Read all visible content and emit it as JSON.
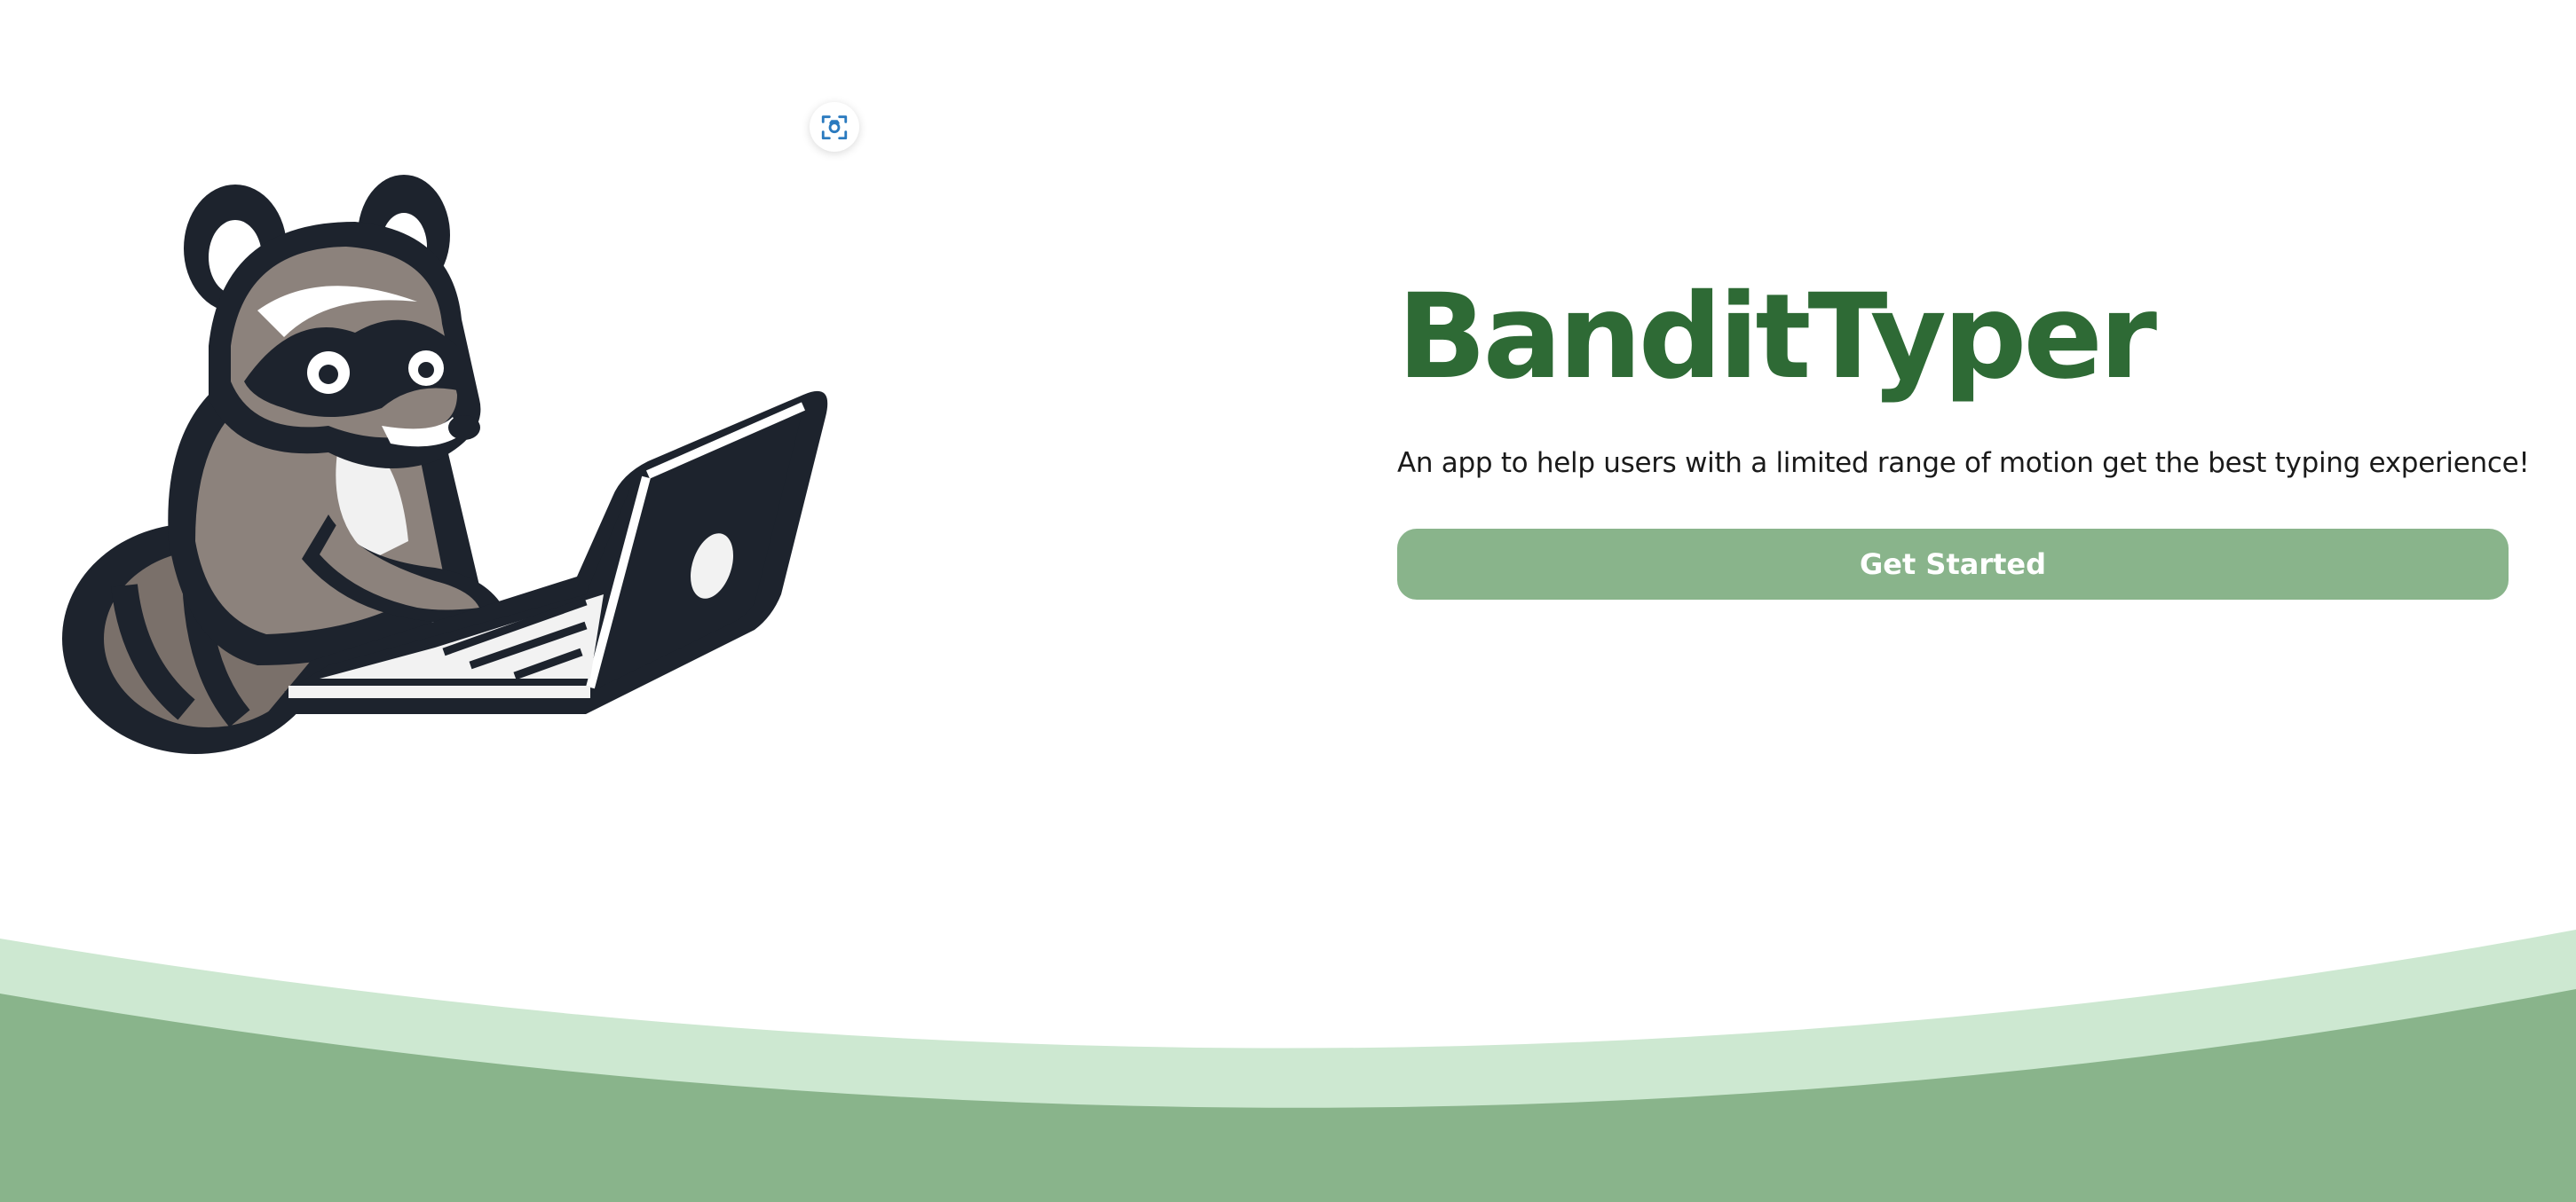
{
  "hero": {
    "title": "BanditTyper",
    "subtitle": "An app to help users with a limited range of motion get the best typing experience!",
    "cta_label": "Get Started"
  },
  "icons": {
    "scan": "scan-focus-icon",
    "mascot": "raccoon-with-laptop-illustration"
  },
  "colors": {
    "title": "#2e6a35",
    "cta": "#89b48b",
    "wave_light": "#cde8d1",
    "wave_dark": "#89b48b",
    "scan_icon": "#2a7abf"
  }
}
